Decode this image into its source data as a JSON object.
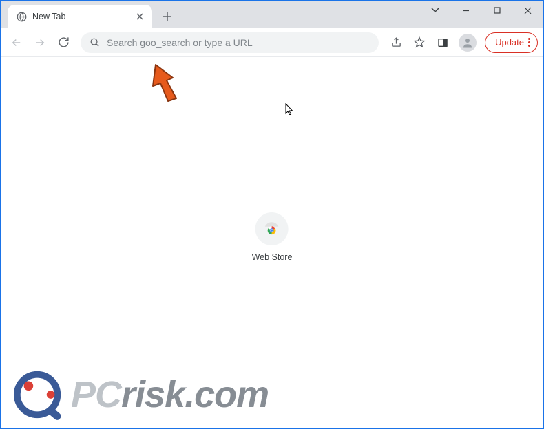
{
  "tab": {
    "title": "New Tab"
  },
  "omnibox": {
    "placeholder": "Search goo_search or type a URL"
  },
  "toolbar": {
    "update_label": "Update"
  },
  "shortcuts": {
    "webstore_label": "Web Store"
  },
  "watermark": {
    "pc": "PC",
    "risk": "risk",
    "com": ".com"
  }
}
